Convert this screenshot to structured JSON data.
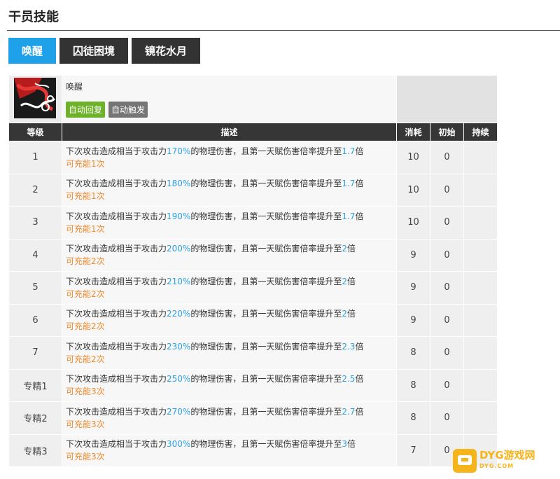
{
  "page_title": "干员技能",
  "tabs": [
    {
      "label": "唤醒",
      "active": true
    },
    {
      "label": "囚徒困境",
      "active": false
    },
    {
      "label": "镜花水月",
      "active": false
    }
  ],
  "skill": {
    "name": "唤醒",
    "icon": "skill-art-icon",
    "badges": [
      "自动回复",
      "自动触发"
    ]
  },
  "columns": [
    "等级",
    "描述",
    "消耗",
    "初始",
    "持续"
  ],
  "desc_parts": {
    "prefix": "下次攻击造成相当于攻击力",
    "middle": "的物理伤害，且第一天赋伤害倍率提升至",
    "suffix": "倍"
  },
  "rows": [
    {
      "level": "1",
      "atk": "170%",
      "mult": "1.7",
      "charges": "可充能1次",
      "cost": "10",
      "init": "0",
      "duration": ""
    },
    {
      "level": "2",
      "atk": "180%",
      "mult": "1.7",
      "charges": "可充能1次",
      "cost": "10",
      "init": "0",
      "duration": ""
    },
    {
      "level": "3",
      "atk": "190%",
      "mult": "1.7",
      "charges": "可充能1次",
      "cost": "10",
      "init": "0",
      "duration": ""
    },
    {
      "level": "4",
      "atk": "200%",
      "mult": "2",
      "charges": "可充能2次",
      "cost": "9",
      "init": "0",
      "duration": ""
    },
    {
      "level": "5",
      "atk": "210%",
      "mult": "2",
      "charges": "可充能2次",
      "cost": "9",
      "init": "0",
      "duration": ""
    },
    {
      "level": "6",
      "atk": "220%",
      "mult": "2",
      "charges": "可充能2次",
      "cost": "9",
      "init": "0",
      "duration": ""
    },
    {
      "level": "7",
      "atk": "230%",
      "mult": "2.3",
      "charges": "可充能2次",
      "cost": "8",
      "init": "0",
      "duration": ""
    },
    {
      "level": "专精1",
      "atk": "250%",
      "mult": "2.5",
      "charges": "可充能3次",
      "cost": "8",
      "init": "0",
      "duration": ""
    },
    {
      "level": "专精2",
      "atk": "270%",
      "mult": "2.7",
      "charges": "可充能3次",
      "cost": "8",
      "init": "0",
      "duration": ""
    },
    {
      "level": "专精3",
      "atk": "300%",
      "mult": "3",
      "charges": "可充能3次",
      "cost": "7",
      "init": "0",
      "duration": ""
    }
  ],
  "watermark": {
    "text": "DYG游戏网",
    "sub": "DYG.COM"
  },
  "colors": {
    "active_tab": "#1ea1e8",
    "highlight": "#2fa0e0",
    "charge": "#f08a2c",
    "badge_auto_recover": "#6eb22a",
    "badge_auto_trigger": "#757575"
  }
}
